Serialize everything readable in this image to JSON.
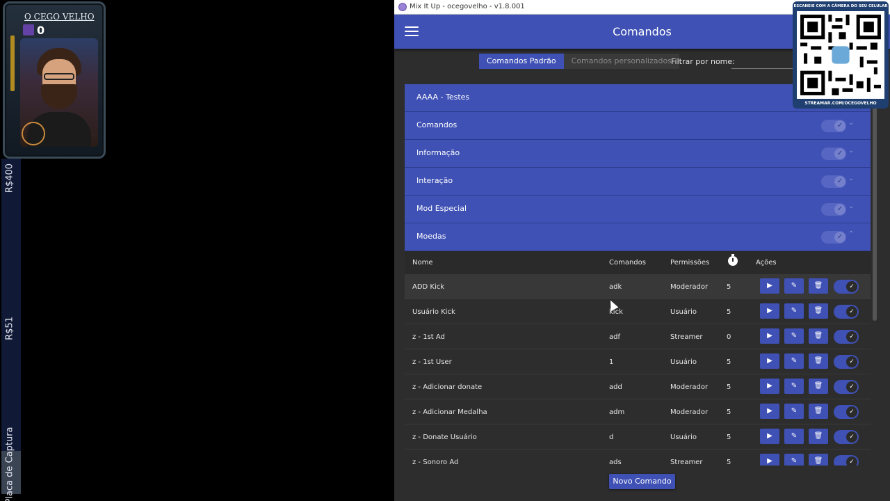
{
  "overlay": {
    "cam_title": "O CEGO VELHO",
    "cam_count": "0",
    "side_labels": [
      "R$400",
      "R$51",
      "Placa de Captura"
    ],
    "qr_top": "ESCANEIE COM A CÂMERA DO SEU CELULAR",
    "qr_bottom": "STREAMAR.COM/OCEGOVELHO"
  },
  "window": {
    "title": "Mix It Up - ocegovelho - v1.8.001",
    "page_title": "Comandos"
  },
  "tabs": [
    {
      "label": "Comandos Padrão",
      "active": true
    },
    {
      "label": "Comandos personalizados",
      "active": false
    }
  ],
  "filter": {
    "label": "Filtrar por nome:",
    "value": ""
  },
  "groups": [
    {
      "label": "AAAA - Testes"
    },
    {
      "label": "Comandos"
    },
    {
      "label": "Informação"
    },
    {
      "label": "Interação"
    },
    {
      "label": "Mod Especial"
    },
    {
      "label": "Moedas"
    }
  ],
  "table": {
    "headers": {
      "name": "Nome",
      "commands": "Comandos",
      "permissions": "Permissões",
      "actions": "Ações"
    },
    "rows": [
      {
        "name": "ADD Kick",
        "command": "adk",
        "permission": "Moderador",
        "cooldown": "5"
      },
      {
        "name": "Usuário Kick",
        "command": "kick",
        "permission": "Usuário",
        "cooldown": "5"
      },
      {
        "name": "z - 1st Ad",
        "command": "adf",
        "permission": "Streamer",
        "cooldown": "0"
      },
      {
        "name": "z - 1st User",
        "command": "1",
        "permission": "Usuário",
        "cooldown": "5"
      },
      {
        "name": "z - Adicionar donate",
        "command": "add",
        "permission": "Moderador",
        "cooldown": "5"
      },
      {
        "name": "z - Adicionar Medalha",
        "command": "adm",
        "permission": "Moderador",
        "cooldown": "5"
      },
      {
        "name": "z - Donate Usuário",
        "command": "d",
        "permission": "Usuário",
        "cooldown": "5"
      },
      {
        "name": "z - Sonoro Ad",
        "command": "ads",
        "permission": "Streamer",
        "cooldown": "5"
      }
    ]
  },
  "new_command_label": "Novo Comando",
  "colors": {
    "accent": "#3f51b5",
    "background": "#2d2d2d"
  }
}
